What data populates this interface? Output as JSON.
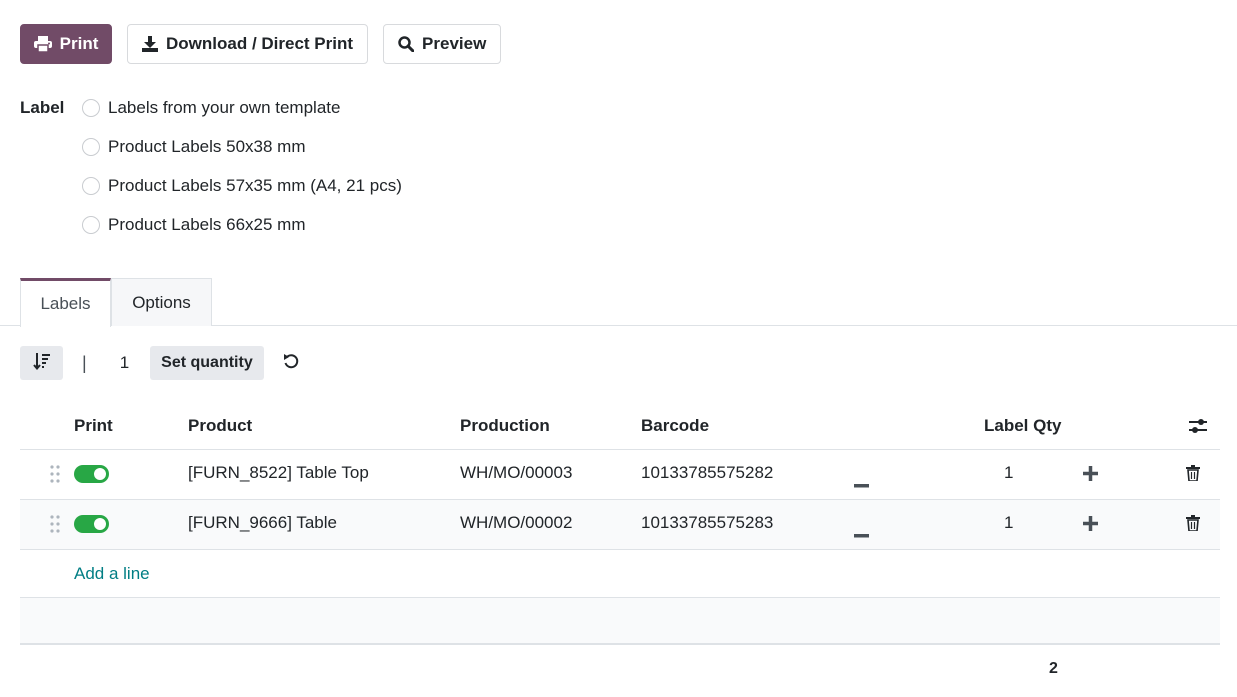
{
  "toolbar": {
    "print_label": "Print",
    "download_label": "Download / Direct Print",
    "preview_label": "Preview"
  },
  "label_section": {
    "title": "Label",
    "options": [
      "Labels from your own template",
      "Product Labels 50x38 mm",
      "Product Labels 57x35 mm (A4, 21 pcs)",
      "Product Labels 66x25 mm"
    ]
  },
  "tabs": [
    "Labels",
    "Options"
  ],
  "controls": {
    "separator": "|",
    "quantity": "1",
    "set_quantity_label": "Set quantity"
  },
  "table": {
    "headers": {
      "print": "Print",
      "product": "Product",
      "production": "Production",
      "barcode": "Barcode",
      "label_qty": "Label Qty"
    },
    "rows": [
      {
        "print": true,
        "product": "[FURN_8522] Table Top",
        "production": "WH/MO/00003",
        "barcode": "10133785575282",
        "qty": "1"
      },
      {
        "print": true,
        "product": "[FURN_9666] Table",
        "production": "WH/MO/00002",
        "barcode": "10133785575283",
        "qty": "1"
      }
    ],
    "add_line_label": "Add a line",
    "total_qty": "2"
  },
  "colors": {
    "primary": "#714b67",
    "toggle_on": "#28a745",
    "link": "#017e84"
  },
  "icons": [
    "printer-icon",
    "download-icon",
    "search-icon",
    "sort-icon",
    "reset-icon",
    "column-settings-icon",
    "drag-handle-icon",
    "minus-icon",
    "plus-icon",
    "trash-icon"
  ]
}
